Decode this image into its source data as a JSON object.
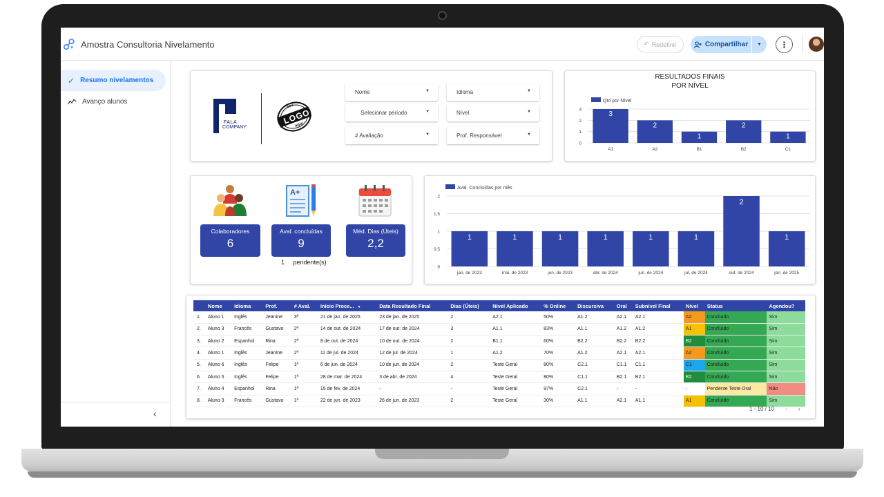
{
  "app": {
    "title": "Amostra Consultoria Nivelamento"
  },
  "toolbar": {
    "reset_label": "Redefinir",
    "share_label": "Compartilhar"
  },
  "sidebar": {
    "items": [
      {
        "label": "Resumo nivelamentos",
        "icon": "check-icon",
        "active": true
      },
      {
        "label": "Avanço alunos",
        "icon": "trend-icon",
        "active": false
      }
    ]
  },
  "brand": {
    "fala_line1": "FALA",
    "fala_line2": "COMPANY",
    "seal_top": "seu",
    "seal_mid": "LOGO",
    "seal_bot": "aqui"
  },
  "filters": {
    "nome": "Nome",
    "idioma": "Idioma",
    "periodo": "Selecionar período",
    "nivel": "Nível",
    "avaliacao": "# Avaliação",
    "prof": "Prof. Responsável"
  },
  "kpis": [
    {
      "label": "Colaboradores",
      "value": "6",
      "icon": "people-icon"
    },
    {
      "label": "Aval. concluídas",
      "value": "9",
      "icon": "test-paper-icon",
      "sub_count": "1",
      "sub_label": "pendente(s)"
    },
    {
      "label": "Méd. Dias (Úteis)",
      "value": "2,2",
      "icon": "calendar-icon"
    }
  ],
  "chart_data": [
    {
      "type": "bar",
      "title": "RESULTADOS FINAIS",
      "subtitle": "POR NÍVEL",
      "legend": "Qtd por Nível",
      "legend_position": "top-left",
      "categories": [
        "A1",
        "A2",
        "B1",
        "B2",
        "C1"
      ],
      "values": [
        3,
        2,
        1,
        2,
        1
      ],
      "ylim": [
        0,
        3
      ],
      "yticks": [
        "0",
        "1",
        "2",
        "3"
      ],
      "grid": true,
      "color": "#3045a5"
    },
    {
      "type": "bar",
      "legend": "Aval. Concluídas por mês",
      "legend_position": "top-left",
      "categories": [
        "jan. de 2023",
        "mai. de 2023",
        "jun. de 2023",
        "abr. de 2024",
        "jun. de 2024",
        "jul. de 2024",
        "out. de 2024",
        "jan. de 2025"
      ],
      "values": [
        1,
        1,
        1,
        1,
        1,
        1,
        2,
        1
      ],
      "ylim": [
        0,
        2
      ],
      "yticks": [
        "0",
        "0,5",
        "1",
        "1,5",
        "2"
      ],
      "grid": true,
      "color": "#3045a5"
    }
  ],
  "table": {
    "columns": [
      "",
      "Nome",
      "Idioma",
      "Prof.",
      "# Aval.",
      "Início Proce...",
      "Data Resultado Final",
      "Dias (Úteis)",
      "Nível Aplicado",
      "% Online",
      "Discursiva",
      "Oral",
      "Subnível Final",
      "Nível",
      "Status",
      "Agendou?"
    ],
    "rows": [
      [
        "1.",
        "Aluno 1",
        "Inglês",
        "Jeanine",
        "3ª",
        "21 de jan. de 2025",
        "23 de jan. de 2025",
        "2",
        "A2.1",
        "50%",
        "A1.2",
        "A2.1",
        "A2.1",
        "A2",
        "Concluído",
        "Sim"
      ],
      [
        "2.",
        "Aluno 3",
        "Francês",
        "Gustavo",
        "2ª",
        "14 de out. de 2024",
        "17 de out. de 2024",
        "3",
        "A1.1",
        "83%",
        "A1.1",
        "A1.2",
        "A1.2",
        "A1",
        "Concluído",
        "Sim"
      ],
      [
        "3.",
        "Aluno 2",
        "Espanhol",
        "Rina",
        "2ª",
        "8 de out. de 2024",
        "10 de out. de 2024",
        "2",
        "B1.1",
        "60%",
        "B2.2",
        "B2.2",
        "B2.2",
        "B2",
        "Concluído",
        "Sim"
      ],
      [
        "4.",
        "Aluno 1",
        "Inglês",
        "Jeanine",
        "2ª",
        "11 de jul. de 2024",
        "12 de jul. de 2024",
        "1",
        "A1.2",
        "70%",
        "A1.2",
        "A2.1",
        "A2.1",
        "A2",
        "Concluído",
        "Sim"
      ],
      [
        "5.",
        "Aluno 6",
        "Inglês",
        "Felipe",
        "1ª",
        "6 de jun. de 2024",
        "10 de jun. de 2024",
        "2",
        "Teste Geral",
        "80%",
        "C2.1",
        "C1.1",
        "C1.1",
        "C1",
        "Concluído",
        "Sim"
      ],
      [
        "6.",
        "Aluno 5",
        "Inglês",
        "Felipe",
        "1ª",
        "28 de mar. de 2024",
        "3 de abr. de 2024",
        "4",
        "Teste Geral",
        "80%",
        "C1.1",
        "B2.1",
        "B2.1",
        "B2",
        "Concluído",
        "Sim"
      ],
      [
        "7.",
        "Aluno 4",
        "Espanhol",
        "Rina",
        "1ª",
        "15 de fev. de 2024",
        "-",
        "-",
        "Teste Geral",
        "97%",
        "C2.1",
        "-",
        "-",
        "-",
        "Pendente Teste Oral",
        "Não"
      ],
      [
        "8.",
        "Aluno 3",
        "Francês",
        "Gustavo",
        "1ª",
        "22 de jun. de 2023",
        "26 de jun. de 2023",
        "2",
        "Teste Geral",
        "30%",
        "A1.1",
        "A2.1",
        "A1.1",
        "A1",
        "Concluído",
        "Sim"
      ]
    ],
    "level_colors": {
      "A1": "#f6c100",
      "A2": "#f39a1e",
      "B2": "#1e8e3e",
      "C1": "#1aa7ec",
      "-": "#ffffff"
    },
    "status_colors": {
      "Concluído": "#34a853",
      "Pendente Teste Oral": "#fbe9a4"
    },
    "agendou_colors": {
      "Sim": "#8ddc9b",
      "Não": "#f28b82"
    },
    "pager": "1 - 10 / 10"
  },
  "colors": {
    "accent": "#1a73e8",
    "bar": "#3045a5",
    "share_bg": "#c6e2fb"
  }
}
